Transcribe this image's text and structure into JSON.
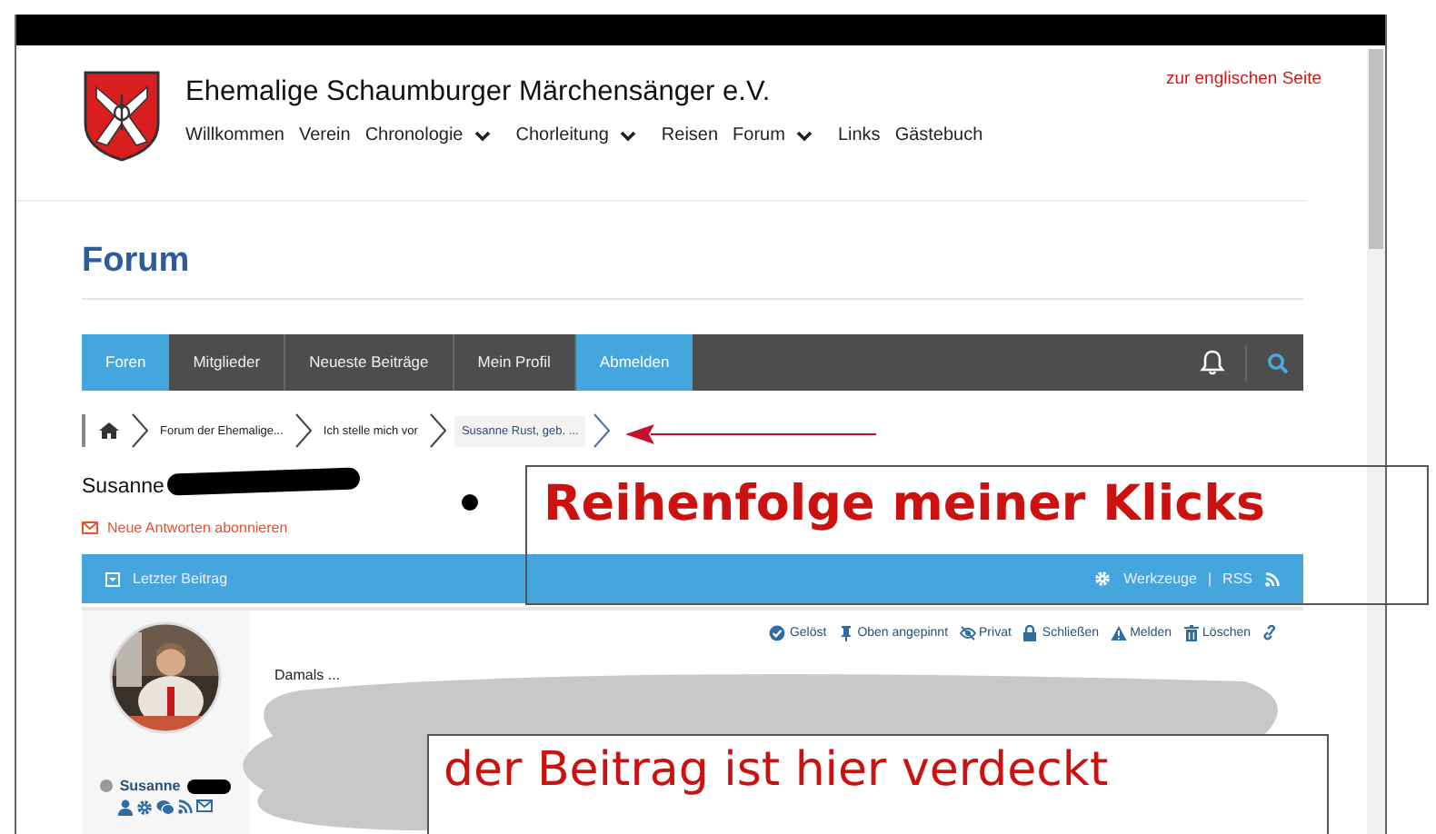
{
  "site": {
    "title": "Ehemalige Schaumburger Märchensänger e.V.",
    "language_link": "zur englischen Seite",
    "nav": [
      {
        "label": "Willkommen",
        "has_menu": false
      },
      {
        "label": "Verein",
        "has_menu": false
      },
      {
        "label": "Chronologie",
        "has_menu": true
      },
      {
        "label": "Chorleitung",
        "has_menu": true
      },
      {
        "label": "Reisen",
        "has_menu": false
      },
      {
        "label": "Forum",
        "has_menu": true
      },
      {
        "label": "Links",
        "has_menu": false
      },
      {
        "label": "Gästebuch",
        "has_menu": false
      }
    ]
  },
  "page_title": "Forum",
  "forum_nav": {
    "tabs": [
      {
        "label": "Foren",
        "highlighted": true
      },
      {
        "label": "Mitglieder",
        "highlighted": false
      },
      {
        "label": "Neueste Beiträge",
        "highlighted": false
      },
      {
        "label": "Mein Profil",
        "highlighted": false
      },
      {
        "label": "Abmelden",
        "highlighted": true
      }
    ]
  },
  "breadcrumbs": [
    {
      "label": "Forum der Ehemalige...",
      "selected": false
    },
    {
      "label": "Ich stelle mich vor",
      "selected": false
    },
    {
      "label": "Susanne Rust, geb. ...",
      "selected": true
    }
  ],
  "topic": {
    "title": "Susanne",
    "subscribe": "Neue Antworten abonnieren"
  },
  "topic_bar": {
    "latest": "Letzter Beitrag",
    "tools": "Werkzeuge",
    "separator": "|",
    "rss": "RSS"
  },
  "post": {
    "author": "Susanne",
    "online": false,
    "actions": [
      {
        "kind": "solved",
        "label": "Gelöst"
      },
      {
        "kind": "pin",
        "label": "Oben angepinnt"
      },
      {
        "kind": "private",
        "label": "Privat"
      },
      {
        "kind": "lock",
        "label": "Schließen"
      },
      {
        "kind": "report",
        "label": "Melden"
      },
      {
        "kind": "delete",
        "label": "Löschen"
      },
      {
        "kind": "link"
      }
    ],
    "text": "Damals ..."
  },
  "annotations": [
    {
      "kind": "large",
      "text": "Reihenfolge meiner Klicks"
    },
    {
      "kind": "normal",
      "text": "der Beitrag ist hier verdeckt"
    }
  ]
}
